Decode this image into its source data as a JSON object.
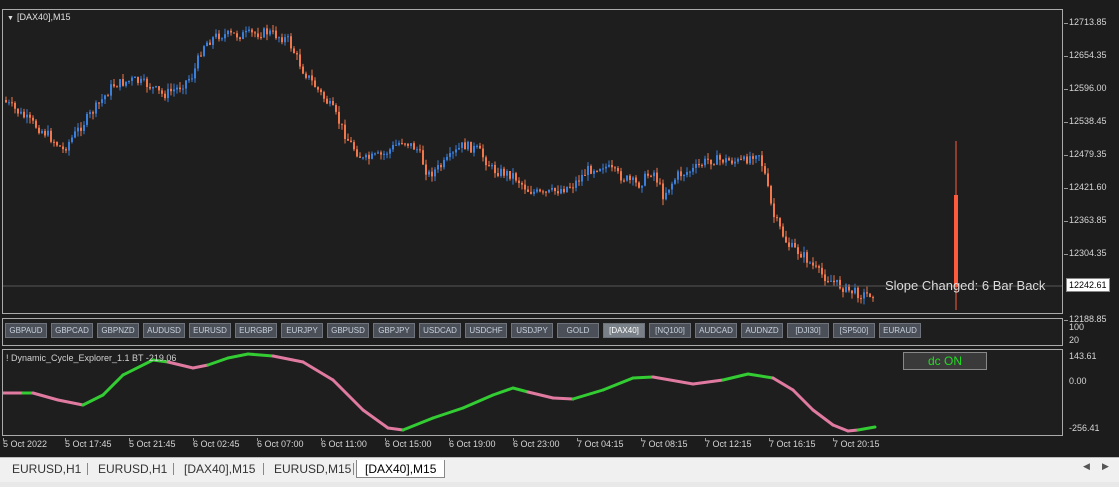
{
  "chart": {
    "title": "[DAX40],M15",
    "price_labels": [
      "12713.85",
      "12654.35",
      "12596.00",
      "12538.45",
      "12479.35",
      "12421.60",
      "12363.85",
      "12304.35",
      "12242.61",
      "12188.85"
    ],
    "current_price": "12242.61",
    "slope_text": "Slope Changed: 6 Bar Back",
    "colors": {
      "bull": "#3b7fd9",
      "bear": "#f0784b",
      "background": "#1e1e1e",
      "marker": "#ff5a3c"
    }
  },
  "symbols": [
    "GBPAUD",
    "GBPCAD",
    "GBPNZD",
    "AUDUSD",
    "EURUSD",
    "EURGBP",
    "EURJPY",
    "GBPUSD",
    "GBPJPY",
    "USDCAD",
    "USDCHF",
    "USDJPY",
    "GOLD",
    "[DAX40]",
    "[NQ100]",
    "AUDCAD",
    "AUDNZD",
    "[DJI30]",
    "[SP500]",
    "EURAUD"
  ],
  "active_symbol": "[DAX40]",
  "button_pane_scale": [
    "100",
    "20"
  ],
  "indicator": {
    "title": "! Dynamic_Cycle_Explorer_1.1 BT -219.06",
    "dc_button": "dc ON",
    "scale": [
      "143.61",
      "0.00",
      "-256.41"
    ],
    "colors": {
      "up": "#33cc33",
      "down": "#e07aa0"
    }
  },
  "time_labels": [
    "5 Oct 2022",
    "5 Oct 17:45",
    "5 Oct 21:45",
    "6 Oct 02:45",
    "6 Oct 07:00",
    "6 Oct 11:00",
    "6 Oct 15:00",
    "6 Oct 19:00",
    "6 Oct 23:00",
    "7 Oct 04:15",
    "7 Oct 08:15",
    "7 Oct 12:15",
    "7 Oct 16:15",
    "7 Oct 20:15"
  ],
  "tabs": [
    "EURUSD,H1",
    "EURUSD,H1",
    "[DAX40],M15",
    "EURUSD,M15",
    "[DAX40],M15"
  ],
  "active_tab": 4
}
